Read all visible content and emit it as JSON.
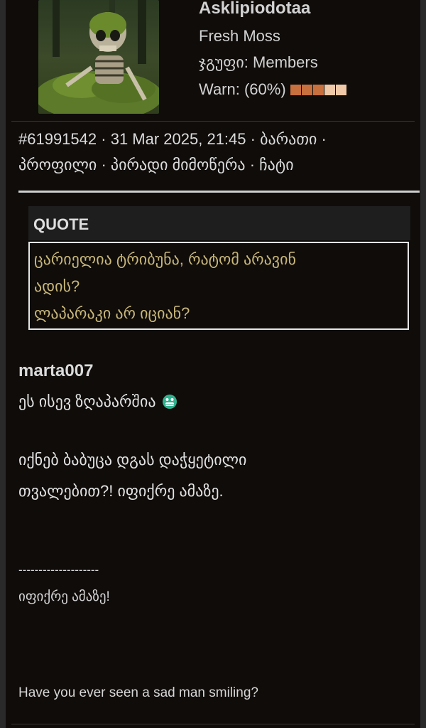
{
  "profile": {
    "username": "Asklipiodotaa",
    "rank": "Fresh Moss",
    "group_label": "ჯგუფი: Members",
    "warn_label": "Warn: (60%)",
    "warn_level_percent": 60,
    "warn_colors": [
      "#c8703e",
      "#c8703e",
      "#c8703e",
      "#f0c9a8",
      "#f0c9a8"
    ]
  },
  "meta": {
    "post_id": "#61991542",
    "datetime": "31 Mar 2025, 21:45",
    "link_card": "ბარათი",
    "link_profile": "პროფილი",
    "link_pm": "პირადი მიმოწერა",
    "link_chat": "ჩატი",
    "separator": "·"
  },
  "quote": {
    "header": "QUOTE",
    "lines": [
      "ცარიელია ტრიბუნა, რატომ არავინ",
      "ადის?",
      "ლაპარაკი არ იციან?"
    ]
  },
  "post": {
    "author": "marta007",
    "line1": "ეს ისევ ზღაპარშია",
    "line2": "იქნებ ბაბუცა დგას დაჭყეტილი",
    "line3": "თვალებით?! იფიქრე ამაზე."
  },
  "signature": {
    "divider": "--------------------",
    "line1": "იფიქრე ამაზე!",
    "line2": "Have you ever seen a sad man smiling?"
  },
  "colors": {
    "background": "#0f0c0a",
    "quote_text": "#c9b77a",
    "text": "#e2e2e2"
  }
}
